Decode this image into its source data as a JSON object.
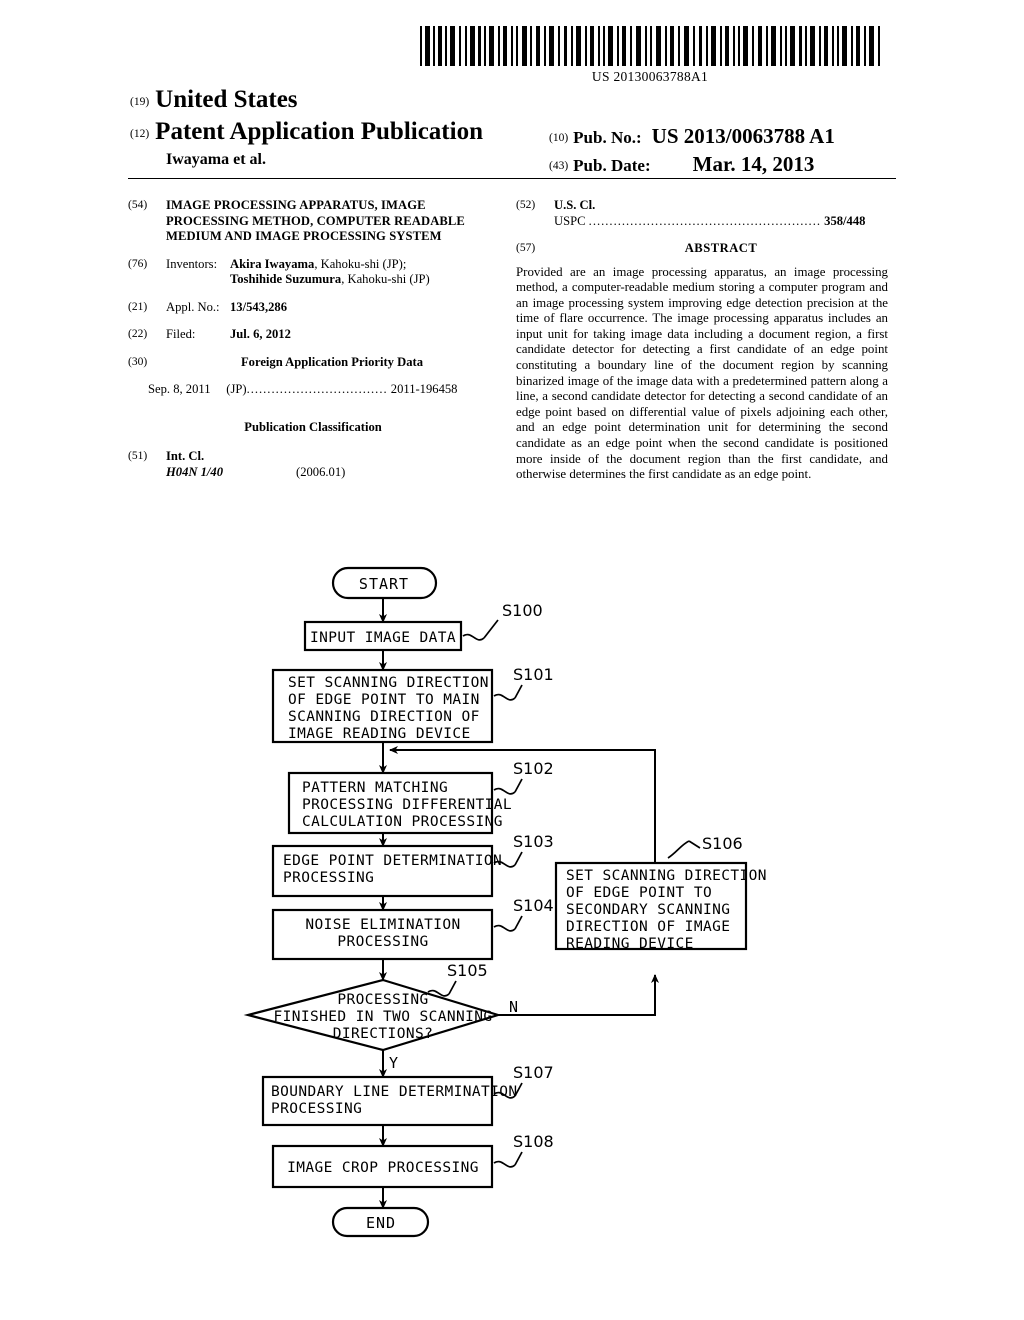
{
  "barcode": {
    "number": "US 20130063788A1",
    "icon": "barcode-icon"
  },
  "header": {
    "country_code": "(19)",
    "country": "United States",
    "doc_code": "(12)",
    "doc_type": "Patent Application Publication",
    "authors": "Iwayama et al.",
    "pubno_code": "(10)",
    "pubno_label": "Pub. No.:",
    "pubno_value": "US 2013/0063788 A1",
    "pubdate_code": "(43)",
    "pubdate_label": "Pub. Date:",
    "pubdate_value": "Mar. 14, 2013"
  },
  "left_column": {
    "title_code": "(54)",
    "title": "IMAGE PROCESSING APPARATUS, IMAGE PROCESSING METHOD, COMPUTER READABLE MEDIUM AND IMAGE PROCESSING SYSTEM",
    "inventors_code": "(76)",
    "inventors_label": "Inventors:",
    "inventor_1_name": "Akira Iwayama",
    "inventor_1_city": ", Kahoku-shi (JP);",
    "inventor_2_name": "Toshihide Suzumura",
    "inventor_2_city": ", Kahoku-shi (JP)",
    "applno_code": "(21)",
    "applno_label": "Appl. No.:",
    "applno_value": "13/543,286",
    "filed_code": "(22)",
    "filed_label": "Filed:",
    "filed_value": "Jul. 6, 2012",
    "foreign_code": "(30)",
    "foreign_heading": "Foreign Application Priority Data",
    "priority_date": "Sep. 8, 2011",
    "priority_country": "(JP)",
    "priority_dots": "..................................",
    "priority_number": "2011-196458",
    "pubclass_heading": "Publication Classification",
    "intcl_code": "(51)",
    "intcl_label": "Int. Cl.",
    "intcl_value": "H04N 1/40",
    "intcl_version": "(2006.01)"
  },
  "right_column": {
    "uscl_code": "(52)",
    "uscl_label": "U.S. Cl.",
    "uspc_label": "USPC",
    "uspc_dots": "........................................................",
    "uspc_value": "358/448",
    "abstract_code": "(57)",
    "abstract_heading": "ABSTRACT",
    "abstract_text": "Provided are an image processing apparatus, an image processing method, a computer-readable medium storing a computer program and an image processing system improving edge detection precision at the time of flare occurrence. The image processing apparatus includes an input unit for taking image data including a document region, a first candidate detector for detecting a first candidate of an edge point constituting a boundary line of the document region by scanning binarized image of the image data with a predetermined pattern along a line, a second candidate detector for detecting a second candidate of an edge point based on differential value of pixels adjoining each other, and an edge point determination unit for determining the second candidate as an edge point when the second candidate is positioned more inside of the document region than the first candidate, and otherwise determines the first candidate as an edge point."
  },
  "flowchart": {
    "start_label": "START",
    "end_label": "END",
    "yes_label": "Y",
    "no_label": "N",
    "steps": [
      {
        "id": "S100",
        "lines": [
          "INPUT IMAGE DATA"
        ]
      },
      {
        "id": "S101",
        "lines": [
          "SET SCANNING DIRECTION",
          "OF EDGE POINT TO MAIN",
          "SCANNING DIRECTION OF",
          "IMAGE READING DEVICE"
        ]
      },
      {
        "id": "S102",
        "lines": [
          "PATTERN MATCHING",
          "PROCESSING DIFFERENTIAL",
          "CALCULATION PROCESSING"
        ]
      },
      {
        "id": "S103",
        "lines": [
          "EDGE POINT DETERMINATION",
          "PROCESSING"
        ]
      },
      {
        "id": "S104",
        "lines": [
          "NOISE ELIMINATION",
          "PROCESSING"
        ]
      },
      {
        "id": "S105",
        "lines": [
          "PROCESSING",
          "FINISHED IN TWO SCANNING",
          "DIRECTIONS?"
        ]
      },
      {
        "id": "S106",
        "lines": [
          "SET SCANNING DIRECTION",
          "OF EDGE POINT TO",
          "SECONDARY SCANNING",
          "DIRECTION OF IMAGE",
          "READING DEVICE"
        ]
      },
      {
        "id": "S107",
        "lines": [
          "BOUNDARY LINE DETERMINATION",
          "PROCESSING"
        ]
      },
      {
        "id": "S108",
        "lines": [
          "IMAGE CROP PROCESSING"
        ]
      }
    ]
  }
}
